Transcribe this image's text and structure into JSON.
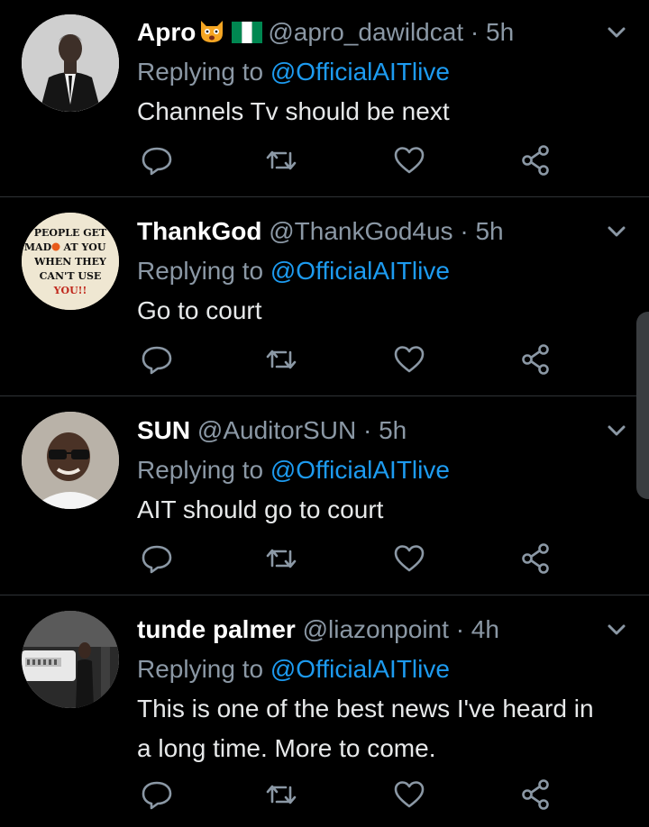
{
  "colors": {
    "background": "#000000",
    "link": "#1d9bf0",
    "muted": "#8b98a5",
    "divider": "#2f3336"
  },
  "tweets": [
    {
      "name": "Apro",
      "emoji": "weary-cat-emoji",
      "flag": "nigeria-flag",
      "handle": "@apro_dawildcat",
      "dot": "·",
      "time": "5h",
      "replying_prefix": "Replying to",
      "reply_to": "@OfficialAITlive",
      "text_lines": [
        "Channels Tv should be next"
      ],
      "avatar": "man-in-black-suit-photo"
    },
    {
      "name": "ThankGod",
      "handle": "@ThankGod4us",
      "dot": "·",
      "time": "5h",
      "replying_prefix": "Replying to",
      "reply_to": "@OfficialAITlive",
      "text_lines": [
        "Go to court"
      ],
      "avatar_text": [
        "PEOPLE GET",
        "MAD",
        "AT YOU",
        "WHEN THEY",
        "CAN'T USE",
        "YOU!!"
      ]
    },
    {
      "name": "SUN",
      "handle": "@AuditorSUN",
      "dot": "·",
      "time": "5h",
      "replying_prefix": "Replying to",
      "reply_to": "@OfficialAITlive",
      "text_lines": [
        "AIT should go to court"
      ],
      "avatar": "smiling-man-glasses-photo"
    },
    {
      "name": "tunde palmer",
      "handle": "@liazonpoint",
      "dot": "·",
      "time": "4h",
      "replying_prefix": "Replying to",
      "reply_to": "@OfficialAITlive",
      "text_lines": [
        "This is one of the best news I've heard in",
        "a long time. More to come."
      ],
      "avatar": "man-with-hummer-photo"
    }
  ],
  "actions": [
    "reply-icon",
    "retweet-icon",
    "like-icon",
    "share-icon"
  ]
}
